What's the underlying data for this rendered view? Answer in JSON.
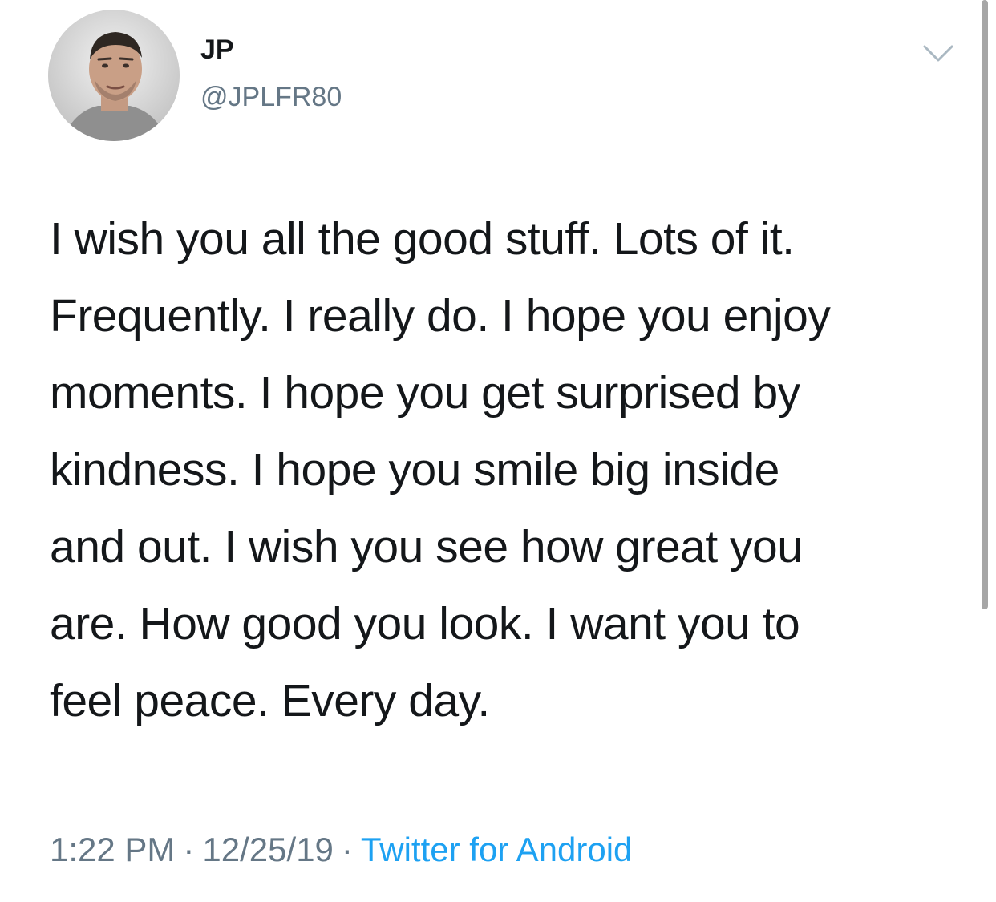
{
  "tweet": {
    "author": {
      "display_name": "JP",
      "handle": "@JPLFR80",
      "avatar_icon": "profile-photo"
    },
    "menu_icon": "chevron-down-icon",
    "text": "I wish you all the good stuff. Lots of it.\nFrequently. I really do. I hope you enjoy\nmoments. I hope you get surprised by\nkindness. I hope you smile big inside\nand out. I wish you see how great you\nare. How good you look. I want you to\nfeel peace. Every day.",
    "time": "1:22 PM",
    "separator": "·",
    "date": "12/25/19",
    "source": "Twitter for Android"
  },
  "colors": {
    "text_primary": "#14171a",
    "text_secondary": "#657786",
    "link": "#1da1f2",
    "background": "#ffffff"
  }
}
